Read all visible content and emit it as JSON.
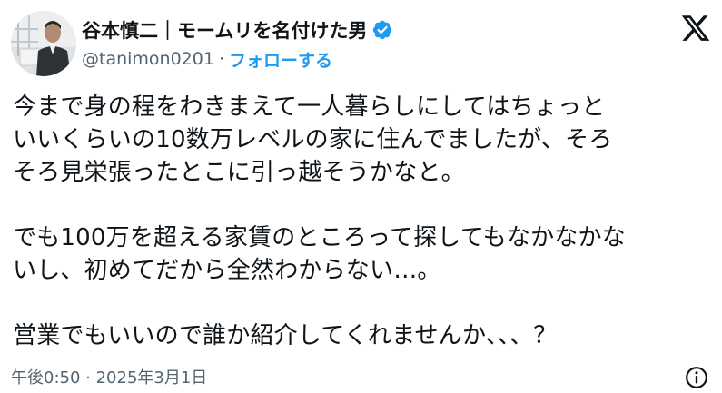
{
  "author": {
    "display_name": "谷本慎二｜モームリを名付けた男",
    "handle": "@tanimon0201",
    "separator": "·",
    "follow_label": "フォローする",
    "verified_icon": "verified-badge-icon",
    "verified_color": "#1d9bf0"
  },
  "post": {
    "paragraphs": [
      [
        "今まで身の程をわきまえて一人暮らしにしてはちょっと",
        "いいくらいの10数万レベルの家に住んでましたが、そろ",
        "そろ見栄張ったとこに引っ越そうかなと。"
      ],
      [
        "でも100万を超える家賃のところって探してもなかなかな",
        "いし、初めてだから全然わからない…。"
      ],
      [
        "営業でもいいので誰か紹介してくれませんか、、、？"
      ]
    ]
  },
  "footer": {
    "timestamp": "午後0:50 · 2025年3月1日",
    "info_icon": "info-icon"
  },
  "colors": {
    "text": "#0f1419",
    "secondary": "#536471",
    "accent": "#1d9bf0"
  }
}
